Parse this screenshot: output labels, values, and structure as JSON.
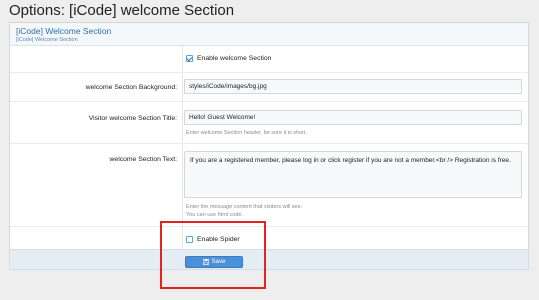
{
  "page": {
    "title": "Options: [iCode] welcome Section"
  },
  "section": {
    "title": "[iCode] Welcome Section",
    "subtitle": "[iCode] Welcome Section"
  },
  "options": {
    "enable_welcome": {
      "label": "Enable welcome Section",
      "checked": true
    },
    "background": {
      "label": "welcome Section Background:",
      "value": "styles/iCode/images/bg.jpg"
    },
    "visitor_title": {
      "label": "Visitor welcome Section Title:",
      "value": "Hello! Guest Welcome!",
      "hint": "Enter welcome Section header, be sure it is short."
    },
    "section_text": {
      "label": "welcome Section Text:",
      "value": "If you are a registered member, please log in or click register if you are not a member.<br /> Registration is free.",
      "hint_line1": "Enter the message content that visitors will see.",
      "hint_line2": "You can use html code."
    },
    "enable_spider": {
      "label": "Enable Spider",
      "checked": false
    }
  },
  "footer": {
    "save_label": "Save",
    "save_icon": "save-icon"
  },
  "colors": {
    "accent": "#4a90d9",
    "highlight": "#e32222"
  }
}
